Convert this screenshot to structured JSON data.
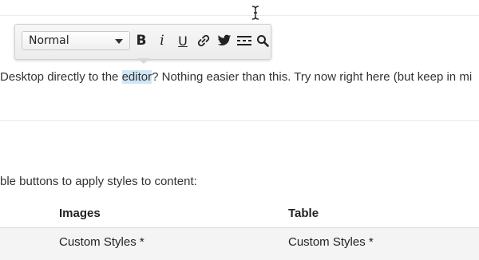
{
  "toolbar": {
    "format_select_value": "Normal",
    "buttons": {
      "bold": "B",
      "italic": "i",
      "underline": "U"
    },
    "icons": [
      "link-icon",
      "twitter-icon",
      "horizontal-rule-icon",
      "search-icon"
    ]
  },
  "editor": {
    "text_before": "Desktop directly to the ",
    "highlighted": "editor",
    "text_after": "? Nothing easier than this. Try now right here (but keep in mi"
  },
  "content": {
    "intro": "ble buttons to apply styles to content:",
    "table": {
      "headers": [
        "Images",
        "Table"
      ],
      "row": [
        "Custom Styles *",
        "Custom Styles *"
      ]
    }
  },
  "colors": {
    "highlight": "#cfe6f5",
    "toolbar_bg": "#f0f0f0"
  }
}
